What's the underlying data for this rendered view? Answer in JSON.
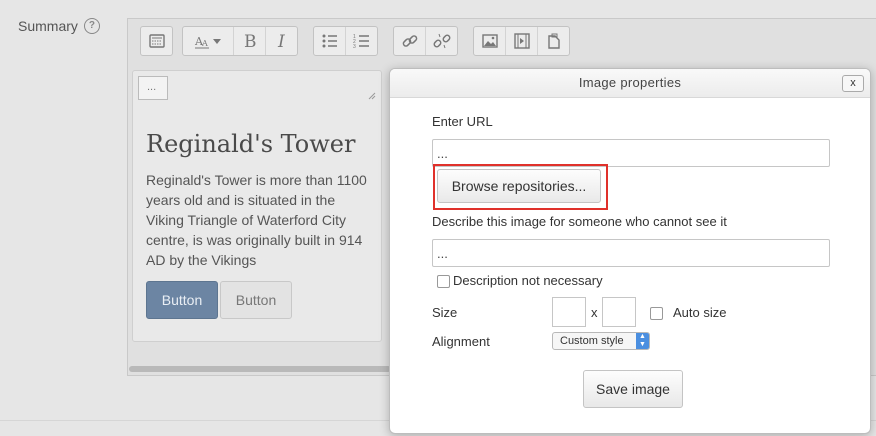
{
  "form": {
    "label": "Summary",
    "help_icon": "question-circle-icon"
  },
  "toolbar": {
    "groups": [
      [
        "collapse-toolbar-icon"
      ],
      [
        "font-style-icon",
        "bold-icon",
        "italic-icon"
      ],
      [
        "bullet-list-icon",
        "numbered-list-icon"
      ],
      [
        "link-icon",
        "unlink-icon"
      ],
      [
        "image-icon",
        "media-icon",
        "file-manager-icon"
      ]
    ]
  },
  "editor": {
    "broken_image_text": "...",
    "heading": "Reginald's Tower",
    "paragraph": "Reginald's Tower is more than 1100 years old and is situated in the Viking Triangle of Waterford City centre, is was originally built in 914 AD by the Vikings",
    "primary_button": "Button",
    "default_button": "Button"
  },
  "dialog": {
    "title": "Image properties",
    "close_label": "x",
    "url_label": "Enter URL",
    "url_value": "...",
    "browse_label": "Browse repositories...",
    "alt_label": "Describe this image for someone who cannot see it",
    "alt_value": "...",
    "presentation_label": "Description not necessary",
    "size_label": "Size",
    "size_sep": "x",
    "auto_size_label": "Auto size",
    "alignment_label": "Alignment",
    "alignment_value": "Custom style",
    "save_label": "Save image"
  },
  "colors": {
    "highlight": "#e0312b",
    "primary_button": "#6c85a3",
    "select_accent": "#4b8fe0"
  }
}
